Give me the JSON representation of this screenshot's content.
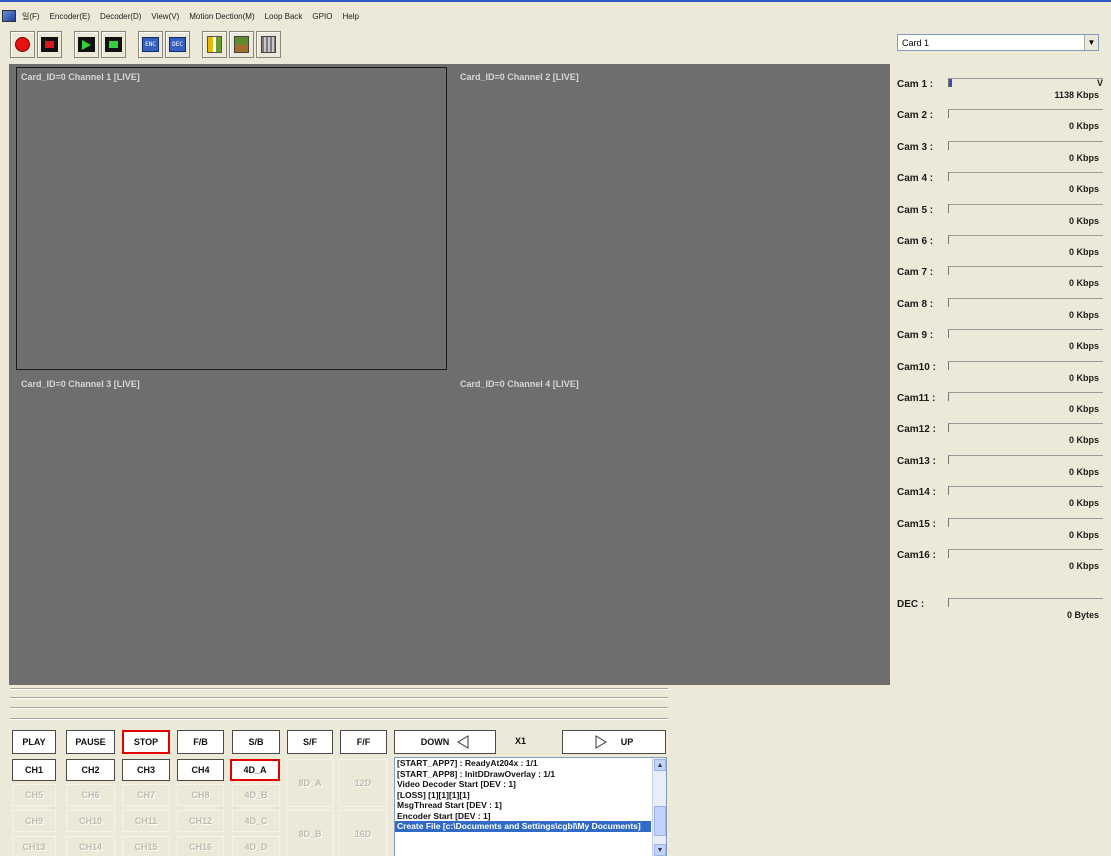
{
  "menu": {
    "items": [
      "일(F)",
      "Encoder(E)",
      "Decoder(D)",
      "View(V)",
      "Motion Dection(M)",
      "Loop Back",
      "GPIO",
      "Help"
    ]
  },
  "toolbar": {
    "icons": [
      "record-icon",
      "record-stop-icon",
      "play-icon",
      "play-stop-icon",
      "encoder-icon",
      "decoder-icon",
      "bar-icon",
      "tree-icon",
      "gate-icon"
    ],
    "encoder_text": "ENC",
    "decoder_text": "DEC"
  },
  "card_select": {
    "value": "Card 1",
    "arrow": "▼"
  },
  "video": {
    "channels": [
      "Card_ID=0 Channel 1 [LIVE]",
      "Card_ID=0 Channel 2 [LIVE]",
      "Card_ID=0 Channel 3 [LIVE]",
      "Card_ID=0 Channel 4 [LIVE]"
    ]
  },
  "cams": [
    {
      "label": "Cam 1 :",
      "rate": "1138 Kbps",
      "fill": 0.02,
      "suffix": "V"
    },
    {
      "label": "Cam 2 :",
      "rate": "0 Kbps",
      "fill": 0
    },
    {
      "label": "Cam 3 :",
      "rate": "0 Kbps",
      "fill": 0
    },
    {
      "label": "Cam 4 :",
      "rate": "0 Kbps",
      "fill": 0
    },
    {
      "label": "Cam 5 :",
      "rate": "0 Kbps",
      "fill": 0
    },
    {
      "label": "Cam 6 :",
      "rate": "0 Kbps",
      "fill": 0
    },
    {
      "label": "Cam 7 :",
      "rate": "0 Kbps",
      "fill": 0
    },
    {
      "label": "Cam 8 :",
      "rate": "0 Kbps",
      "fill": 0
    },
    {
      "label": "Cam 9 :",
      "rate": "0 Kbps",
      "fill": 0
    },
    {
      "label": "Cam10 :",
      "rate": "0 Kbps",
      "fill": 0
    },
    {
      "label": "Cam11 :",
      "rate": "0 Kbps",
      "fill": 0
    },
    {
      "label": "Cam12 :",
      "rate": "0 Kbps",
      "fill": 0
    },
    {
      "label": "Cam13 :",
      "rate": "0 Kbps",
      "fill": 0
    },
    {
      "label": "Cam14 :",
      "rate": "0 Kbps",
      "fill": 0
    },
    {
      "label": "Cam15 :",
      "rate": "0 Kbps",
      "fill": 0
    },
    {
      "label": "Cam16 :",
      "rate": "0 Kbps",
      "fill": 0
    }
  ],
  "dec": {
    "label": "DEC :",
    "rate": "0 Bytes",
    "fill": 0
  },
  "playback": {
    "buttons": [
      "PLAY",
      "PAUSE",
      "STOP",
      "F/B",
      "S/B",
      "S/F",
      "F/F"
    ],
    "down": "DOWN",
    "speed": "X1",
    "up": "UP"
  },
  "channels": {
    "row1": [
      "CH1",
      "CH2",
      "CH3",
      "CH4",
      "4D_A"
    ],
    "row2": [
      "CH5",
      "CH6",
      "CH7",
      "CH8",
      "4D_B"
    ],
    "row3": [
      "CH9",
      "CH10",
      "CH11",
      "CH12",
      "4D_C"
    ],
    "row4": [
      "CH13",
      "CH14",
      "CH15",
      "CH16",
      "4D_D"
    ],
    "group": [
      "8D_A",
      "12D",
      "8D_B",
      "16D"
    ]
  },
  "log": {
    "lines": [
      "[START_APP7] : ReadyAt204x : 1/1",
      "[START_APP8] : InitDDrawOverlay : 1/1",
      "Video Decoder Start [DEV : 1]",
      "[LOSS] [1][1][1][1]",
      "MsgThread Start [DEV : 1]",
      "Encoder Start [DEV : 1]",
      "Create File [c:\\Documents and Settings\\cgbl\\My Documents]"
    ],
    "selected_index": 6
  }
}
